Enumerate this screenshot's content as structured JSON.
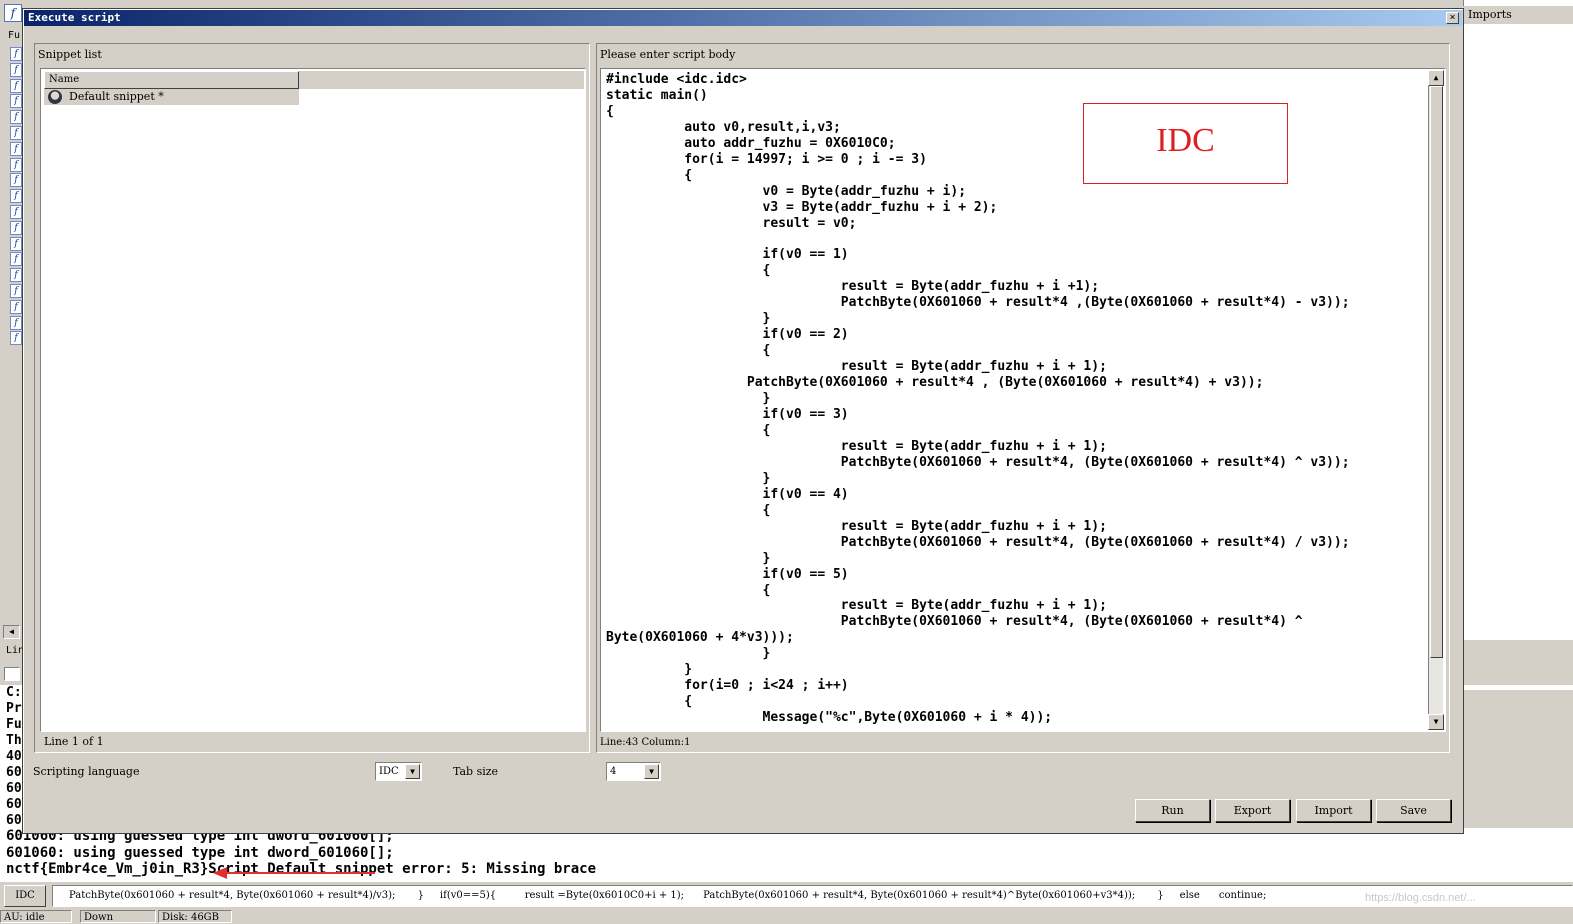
{
  "dialog": {
    "title": "Execute script",
    "close": "×",
    "snippet_list_label": "Snippet list",
    "column_name": "Name",
    "snippet_name": "Default snippet *",
    "snippet_status": "Line 1 of 1",
    "body_label": "Please enter script body",
    "body_status": "Line:43 Column:1",
    "scripting_language_label": "Scripting language",
    "scripting_language_value": "IDC",
    "tab_size_label": "Tab size",
    "tab_size_value": "4",
    "buttons": {
      "run": "Run",
      "export": "Export",
      "import": "Import",
      "save": "Save"
    },
    "annotation_text": "IDC",
    "code": "#include <idc.idc>\nstatic main()\n{\n          auto v0,result,i,v3;\n          auto addr_fuzhu = 0X6010C0;\n          for(i = 14997; i >= 0 ; i -= 3)\n          {\n                    v0 = Byte(addr_fuzhu + i);\n                    v3 = Byte(addr_fuzhu + i + 2);\n                    result = v0;\n\n                    if(v0 == 1)\n                    {\n                              result = Byte(addr_fuzhu + i +1);\n                              PatchByte(0X601060 + result*4 ,(Byte(0X601060 + result*4) - v3));\n                    }\n                    if(v0 == 2)\n                    {\n                              result = Byte(addr_fuzhu + i + 1);\n                  PatchByte(0X601060 + result*4 , (Byte(0X601060 + result*4) + v3));\n                    }\n                    if(v0 == 3)\n                    {\n                              result = Byte(addr_fuzhu + i + 1);\n                              PatchByte(0X601060 + result*4, (Byte(0X601060 + result*4) ^ v3));\n                    }\n                    if(v0 == 4)\n                    {\n                              result = Byte(addr_fuzhu + i + 1);\n                              PatchByte(0X601060 + result*4, (Byte(0X601060 + result*4) / v3));\n                    }\n                    if(v0 == 5)\n                    {\n                              result = Byte(addr_fuzhu + i + 1);\n                              PatchByte(0X601060 + result*4, (Byte(0X601060 + result*4) ^\nByte(0X601060 + 4*v3)));\n                    }\n          }\n          for(i=0 ; i<24 ; i++)\n          {\n                    Message(\"%c\",Byte(0X601060 + i * 4));"
  },
  "background": {
    "right_pane_title": "Imports",
    "left_tab_fu": "Fu",
    "left_tab_lin": "Lin",
    "left_output_chars": [
      "C:",
      "Pr",
      "Fu",
      "Th",
      "40",
      "60",
      "60",
      "60",
      "60"
    ],
    "output_lines": [
      "601060: using guessed type int dword_601060[];",
      "601060: using guessed type int dword_601060[];",
      "nctf{Embr4ce_Vm_j0in_R3}Script Default snippet error: 5: Missing brace"
    ],
    "command_language": "IDC",
    "command_text": "PatchByte(0x601060 + result*4, Byte(0x601060 + result*4)/v3);       }     if(v0==5){         result =Byte(0x6010C0+i + 1);      PatchByte(0x601060 + result*4, Byte(0x601060 + result*4)^Byte(0x601060+v3*4));       }     else      continue;",
    "status": {
      "au": "AU:  idle",
      "down": "Down",
      "disk": "Disk: 46GB"
    },
    "watermark": "https://blog.csdn.net/..."
  },
  "colors": {
    "annotation": "#e02020",
    "title_bar": "#0a246a",
    "arrow": "#e03030"
  }
}
